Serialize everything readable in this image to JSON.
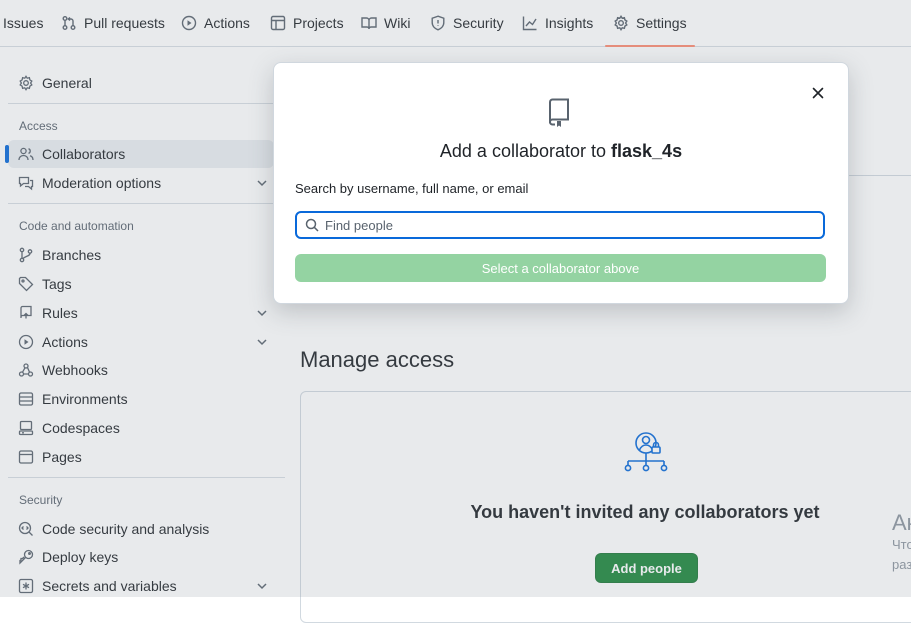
{
  "topnav": {
    "items": [
      {
        "label": "Issues",
        "icon": "issue-icon"
      },
      {
        "label": "Pull requests",
        "icon": "pull-request-icon"
      },
      {
        "label": "Actions",
        "icon": "play-icon"
      },
      {
        "label": "Projects",
        "icon": "table-icon"
      },
      {
        "label": "Wiki",
        "icon": "book-icon"
      },
      {
        "label": "Security",
        "icon": "shield-icon"
      },
      {
        "label": "Insights",
        "icon": "graph-icon"
      },
      {
        "label": "Settings",
        "icon": "gear-icon",
        "selected": true
      }
    ]
  },
  "sidebar": {
    "general": "General",
    "access_heading": "Access",
    "collaborators": "Collaborators",
    "moderation": "Moderation options",
    "code_heading": "Code and automation",
    "branches": "Branches",
    "tags": "Tags",
    "rules": "Rules",
    "actions": "Actions",
    "webhooks": "Webhooks",
    "environments": "Environments",
    "codespaces": "Codespaces",
    "pages": "Pages",
    "security_heading": "Security",
    "code_security": "Code security and analysis",
    "deploy_keys": "Deploy keys",
    "secrets": "Secrets and variables"
  },
  "main": {
    "manage_title": "Manage access",
    "empty_title": "You haven't invited any collaborators yet",
    "add_people": "Add people",
    "cutoff_1": "Ак",
    "cutoff_2": "Что",
    "cutoff_3": "раз"
  },
  "dialog": {
    "title_prefix": "Add a collaborator to ",
    "repo_name": "flask_4s",
    "search_label": "Search by username, full name, or email",
    "search_placeholder": "Find people",
    "select_button": "Select a collaborator above"
  },
  "colors": {
    "accent": "#0969da",
    "selected_underline": "#fd8c73",
    "primary_button": "#1f883d",
    "disabled_button": "#94d3a2"
  }
}
